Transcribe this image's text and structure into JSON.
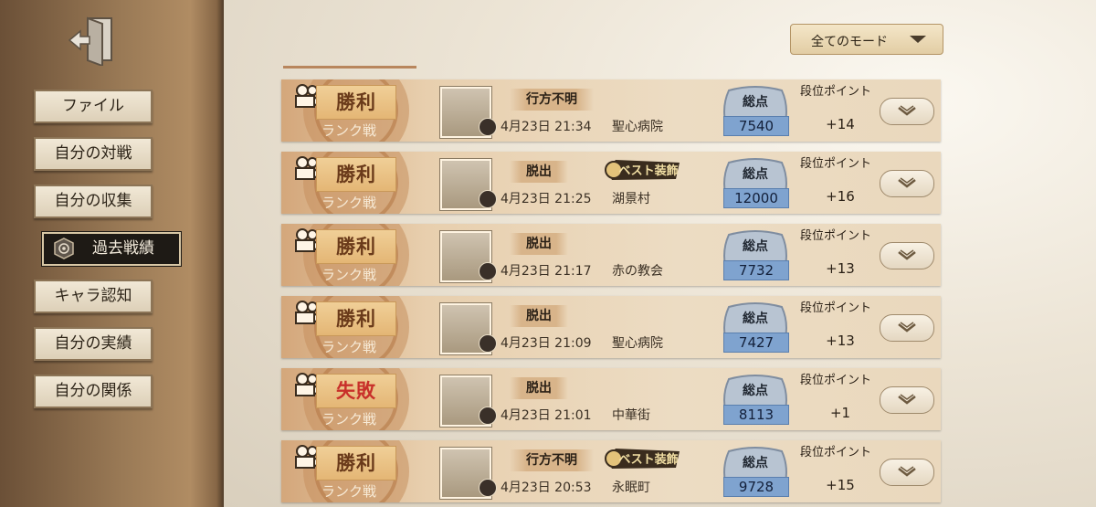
{
  "sidebar": {
    "exit_icon": "exit-door-icon",
    "items": [
      {
        "label": "ファイル"
      },
      {
        "label": "自分の対戦"
      },
      {
        "label": "自分の収集"
      },
      {
        "label": "過去戦績",
        "active": true,
        "icon": "badge-emblem-icon"
      },
      {
        "label": "キャラ認知"
      },
      {
        "label": "自分の実績"
      },
      {
        "label": "自分の関係"
      }
    ]
  },
  "filter": {
    "mode_label": "全てのモード",
    "icon": "chevron-down-icon"
  },
  "matches": [
    {
      "result": "勝利",
      "result_type": "win",
      "mode": "ランク戦",
      "status": "行方不明",
      "best_badge": "",
      "date": "4月23日 21:34",
      "map": "聖心病院",
      "score_label": "総点",
      "score": "7540",
      "points_label": "段位ポイント",
      "points": "+14"
    },
    {
      "result": "勝利",
      "result_type": "win",
      "mode": "ランク戦",
      "status": "脱出",
      "best_badge": "ベスト装飾",
      "date": "4月23日 21:25",
      "map": "湖景村",
      "score_label": "総点",
      "score": "12000",
      "points_label": "段位ポイント",
      "points": "+16"
    },
    {
      "result": "勝利",
      "result_type": "win",
      "mode": "ランク戦",
      "status": "脱出",
      "best_badge": "",
      "date": "4月23日 21:17",
      "map": "赤の教会",
      "score_label": "総点",
      "score": "7732",
      "points_label": "段位ポイント",
      "points": "+13"
    },
    {
      "result": "勝利",
      "result_type": "win",
      "mode": "ランク戦",
      "status": "脱出",
      "best_badge": "",
      "date": "4月23日 21:09",
      "map": "聖心病院",
      "score_label": "総点",
      "score": "7427",
      "points_label": "段位ポイント",
      "points": "+13"
    },
    {
      "result": "失敗",
      "result_type": "lose",
      "mode": "ランク戦",
      "status": "脱出",
      "best_badge": "",
      "date": "4月23日 21:01",
      "map": "中華街",
      "score_label": "総点",
      "score": "8113",
      "points_label": "段位ポイント",
      "points": "+1"
    },
    {
      "result": "勝利",
      "result_type": "win",
      "mode": "ランク戦",
      "status": "行方不明",
      "best_badge": "ベスト装飾",
      "date": "4月23日 20:53",
      "map": "永眠町",
      "score_label": "総点",
      "score": "9728",
      "points_label": "段位ポイント",
      "points": "+15"
    }
  ],
  "colors": {
    "win": "#6a3a1a",
    "lose": "#c8302a",
    "score_plate": "#7fa3cf"
  }
}
